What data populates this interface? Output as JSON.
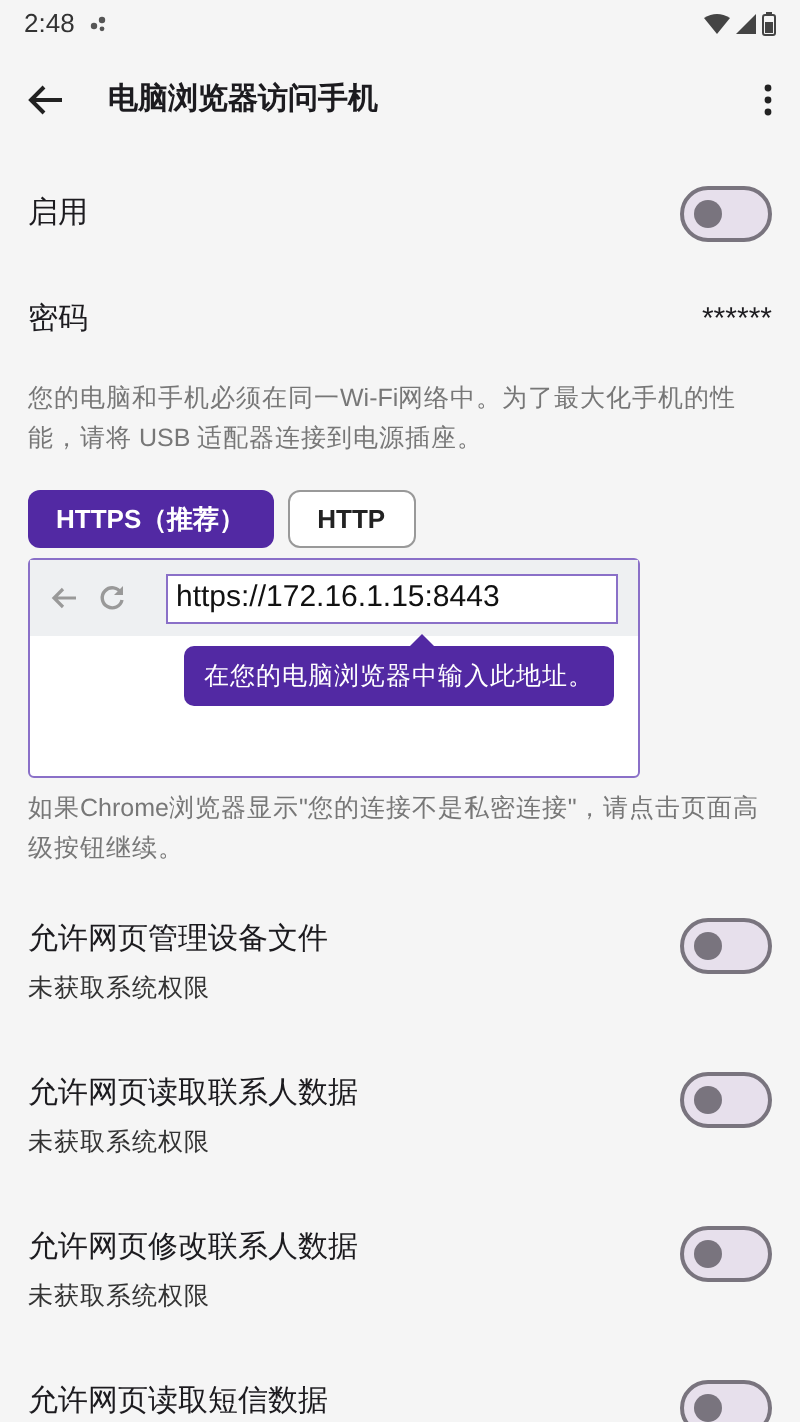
{
  "status_bar": {
    "time": "2:48"
  },
  "app_bar": {
    "title": "电脑浏览器访问手机"
  },
  "enable": {
    "label": "启用",
    "on": false
  },
  "password": {
    "label": "密码",
    "value": "******"
  },
  "description": "您的电脑和手机必须在同一Wi-Fi网络中。为了最大化手机的性能，请将 USB 适配器连接到电源插座。",
  "tabs": [
    {
      "label": "HTTPS（推荐）",
      "selected": true
    },
    {
      "label": "HTTP",
      "selected": false
    }
  ],
  "browser_preview": {
    "address": "https://172.16.1.15:8443",
    "tooltip": "在您的电脑浏览器中输入此地址。"
  },
  "note": "如果Chrome浏览器显示\"您的连接不是私密连接\"，请点击页面高级按钮继续。",
  "permissions": [
    {
      "label": "允许网页管理设备文件",
      "subtitle": "未获取系统权限",
      "on": false
    },
    {
      "label": "允许网页读取联系人数据",
      "subtitle": "未获取系统权限",
      "on": false
    },
    {
      "label": "允许网页修改联系人数据",
      "subtitle": "未获取系统权限",
      "on": false
    },
    {
      "label": "允许网页读取短信数据",
      "on": false
    }
  ]
}
